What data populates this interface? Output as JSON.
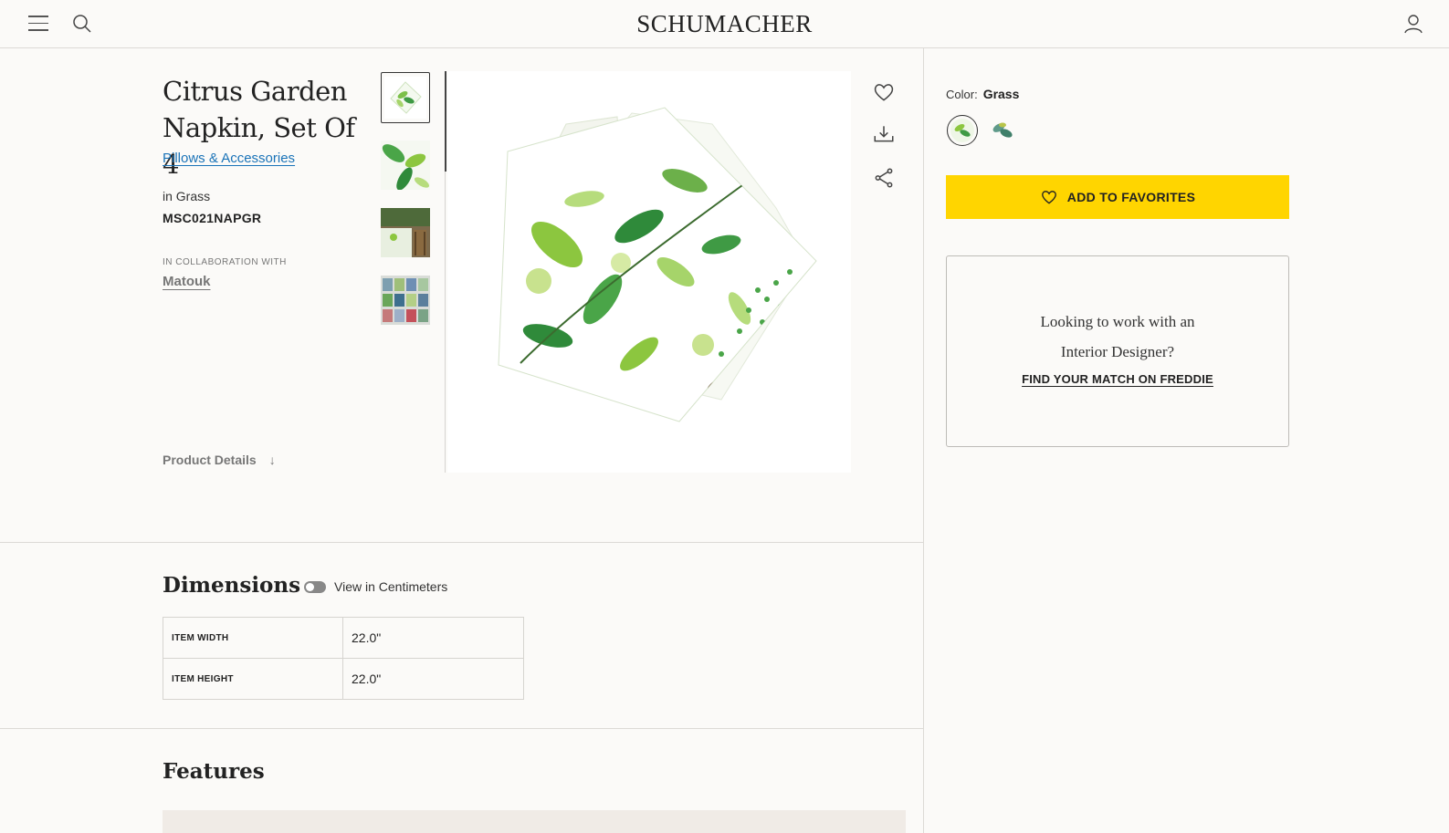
{
  "header": {
    "logo": "SCHUMACHER",
    "icons": {
      "menu": "menu-icon",
      "search": "search-icon",
      "account": "account-icon"
    }
  },
  "product": {
    "title": "Citrus Garden Napkin, Set Of 4",
    "category": "Pillows & Accessories",
    "color_line": "in Grass",
    "sku": "MSC021NAPGR",
    "collab_label": "IN COLLABORATION WITH",
    "collab_partner": "Matouk",
    "details_link": "Product Details",
    "details_arrow": "↓"
  },
  "actions": {
    "favorite": "heart-icon",
    "download": "download-icon",
    "share": "share-icon"
  },
  "sidebar": {
    "color_label": "Color:",
    "color_value": "Grass",
    "add_to_favorites": "ADD TO FAVORITES",
    "designer_question_line1": "Looking to work with an",
    "designer_question_line2": "Interior Designer?",
    "designer_link": "FIND YOUR MATCH ON FREDDIE"
  },
  "dimensions": {
    "title": "Dimensions",
    "toggle_label": "View in Centimeters",
    "toggle_on": false,
    "rows": [
      {
        "label": "ITEM WIDTH",
        "value": "22.0\""
      },
      {
        "label": "ITEM HEIGHT",
        "value": "22.0\""
      }
    ]
  },
  "features": {
    "title": "Features"
  },
  "colors": {
    "accent": "#ffd500",
    "link": "#1a73b8",
    "leaf_dark": "#2f8a3a",
    "leaf_light": "#8cc63f"
  }
}
